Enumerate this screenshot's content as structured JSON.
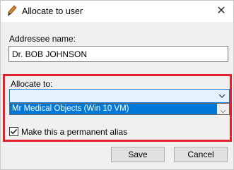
{
  "window": {
    "title": "Allocate to user",
    "close_glyph": "✕"
  },
  "addressee": {
    "label": "Addressee name:",
    "value": "Dr. BOB JOHNSON"
  },
  "allocate": {
    "label": "Allocate to:",
    "selected_value": "",
    "options": [
      "Mr Medical Objects (Win 10 VM)"
    ]
  },
  "alias_checkbox": {
    "label": "Make this a permanent alias",
    "checked": true
  },
  "buttons": {
    "save": "Save",
    "cancel": "Cancel"
  },
  "colors": {
    "highlight": "#e4202b",
    "selection": "#0078d7",
    "combo_bg": "#e5f1fb"
  },
  "icons": {
    "app": "pen-nib-icon",
    "close": "close-icon",
    "dropdown": "chevron-down-icon",
    "check": "checkmark-icon"
  }
}
